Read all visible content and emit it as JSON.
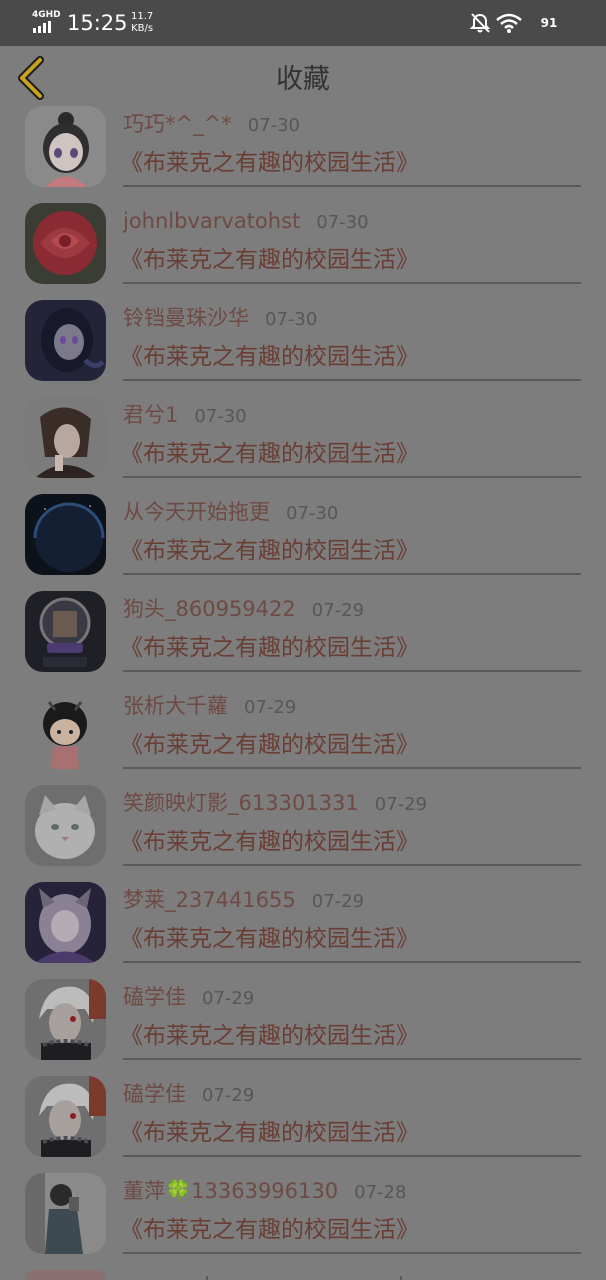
{
  "status_bar": {
    "network": "4GHD",
    "time": "15:25",
    "speed_value": "11.7",
    "speed_unit": "KB/s",
    "battery": "91"
  },
  "header": {
    "title": "收藏",
    "back_icon": "chevron-left-icon"
  },
  "colors": {
    "accent": "#c9a21e",
    "overlay": "#7d7d7d",
    "book_text": "#6a3e34"
  },
  "favorites": [
    {
      "name": "巧巧*^_^*",
      "date": "07-30",
      "book": "《布莱克之有趣的校园生活》",
      "avatar": "anime-girl-avatar"
    },
    {
      "name": "johnlbvarvatohst",
      "date": "07-30",
      "book": "《布莱克之有趣的校园生活》",
      "avatar": "rose-avatar"
    },
    {
      "name": "铃铛曼珠沙华",
      "date": "07-30",
      "book": "《布莱克之有趣的校园生活》",
      "avatar": "dark-anime-girl-avatar"
    },
    {
      "name": "君兮1",
      "date": "07-30",
      "book": "《布莱克之有趣的校园生活》",
      "avatar": "anime-boy-avatar"
    },
    {
      "name": "从今天开始拖更",
      "date": "07-30",
      "book": "《布莱克之有趣的校园生活》",
      "avatar": "planet-avatar"
    },
    {
      "name": "狗头_860959422",
      "date": "07-29",
      "book": "《布莱克之有趣的校园生活》",
      "avatar": "game-frame-avatar"
    },
    {
      "name": "张析大千蘿",
      "date": "07-29",
      "book": "《布莱克之有趣的校园生活》",
      "avatar": "cartoon-girl-avatar"
    },
    {
      "name": "笑颜映灯影_613301331",
      "date": "07-29",
      "book": "《布莱克之有趣的校园生活》",
      "avatar": "white-cat-avatar"
    },
    {
      "name": "梦莱_237441655",
      "date": "07-29",
      "book": "《布莱克之有趣的校园生活》",
      "avatar": "fox-girl-avatar"
    },
    {
      "name": "磕学佳",
      "date": "07-29",
      "book": "《布莱克之有趣的校园生活》",
      "avatar": "white-hair-boy-avatar"
    },
    {
      "name": "磕学佳",
      "date": "07-29",
      "book": "《布莱克之有趣的校园生活》",
      "avatar": "white-hair-boy-avatar"
    },
    {
      "name": "董萍🍀13363996130",
      "date": "07-28",
      "book": "《布莱克之有趣的校园生活》",
      "avatar": "girl-photo-avatar"
    }
  ]
}
